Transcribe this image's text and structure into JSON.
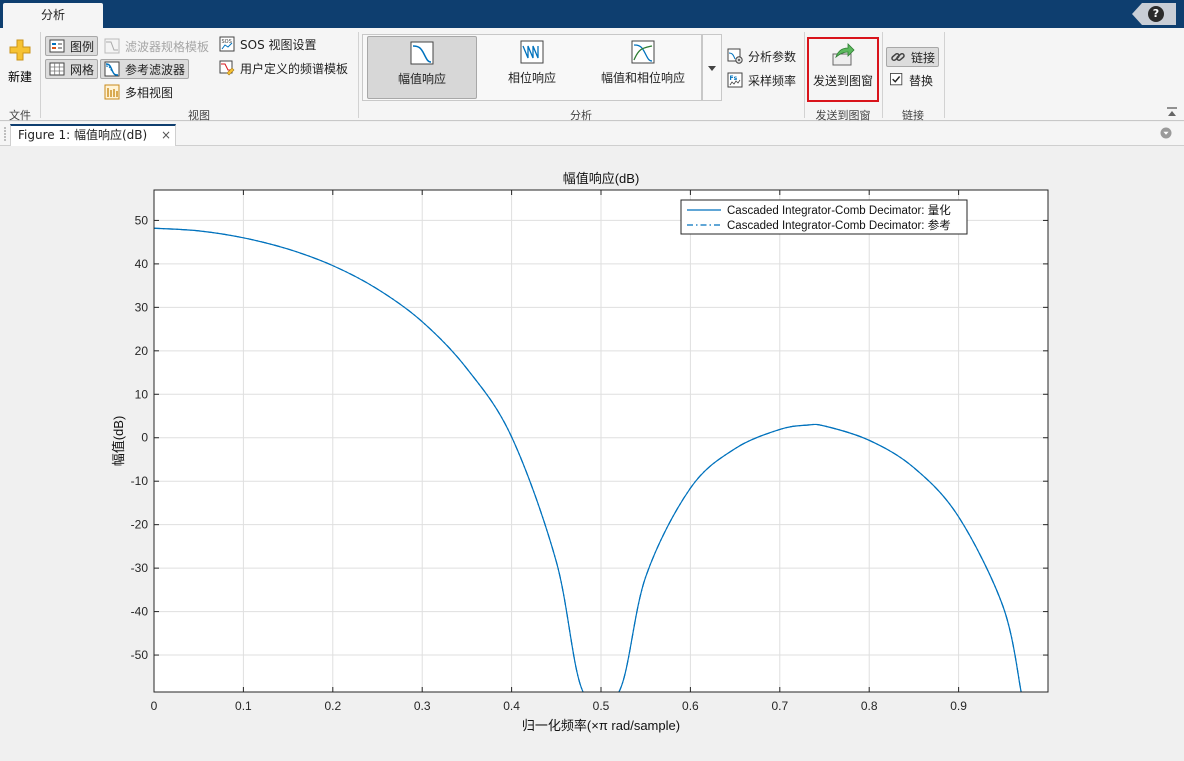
{
  "tabs": {
    "analysis": "分析"
  },
  "help_label": "?",
  "ribbon": {
    "file": {
      "new_label": "新建",
      "section": "文件"
    },
    "view": {
      "section": "视图",
      "legend": "图例",
      "grid": "网格",
      "filter_spec_mask": "滤波器规格模板",
      "reference_filter": "参考滤波器",
      "polyphase_view": "多相视图",
      "sos_view_settings": "SOS 视图设置",
      "user_defined_mask": "用户定义的频谱模板"
    },
    "analysis": {
      "section": "分析",
      "gallery": [
        "幅值响应",
        "相位响应",
        "幅值和相位响应"
      ],
      "analysis_params": "分析参数",
      "sampling_freq": "采样频率"
    },
    "send": {
      "label": "发送到图窗",
      "section": "发送到图窗"
    },
    "link": {
      "label": "链接",
      "replace": "替换",
      "section": "链接"
    }
  },
  "document": {
    "tab_title": "Figure 1: 幅值响应(dB)",
    "close": "×"
  },
  "colors": {
    "accent": "#0e3e6f",
    "series": "#0072bd",
    "highlight": "#d9141b"
  },
  "chart_data": {
    "type": "line",
    "title": "幅值响应(dB)",
    "xlabel": "归一化频率(×π  rad/sample)",
    "ylabel": "幅值(dB)",
    "xlim": [
      0,
      1
    ],
    "ylim": [
      -58.5,
      57
    ],
    "xticks": [
      0,
      0.1,
      0.2,
      0.3,
      0.4,
      0.5,
      0.6,
      0.7,
      0.8,
      0.9
    ],
    "yticks": [
      -50,
      -40,
      -30,
      -20,
      -10,
      0,
      10,
      20,
      30,
      40,
      50
    ],
    "grid": true,
    "legend_position": "top-right",
    "series": [
      {
        "name": "Cascaded Integrator-Comb Decimator: 量化",
        "style": "solid",
        "x": [
          0,
          0.05,
          0.1,
          0.15,
          0.2,
          0.25,
          0.3,
          0.35,
          0.4,
          0.45,
          0.48,
          0.52,
          0.55,
          0.6,
          0.65,
          0.7,
          0.73,
          0.75,
          0.8,
          0.85,
          0.9,
          0.95,
          0.97
        ],
        "y": [
          48.2,
          47.6,
          46.0,
          43.4,
          39.6,
          34.2,
          26.7,
          15.9,
          0.2,
          -28.5,
          -58.5,
          -58.5,
          -32.0,
          -11.6,
          -2.5,
          1.9,
          2.9,
          2.7,
          -0.6,
          -6.9,
          -18.2,
          -39.0,
          -58.5
        ]
      },
      {
        "name": "Cascaded Integrator-Comb Decimator: 参考",
        "style": "dashdot",
        "x": [
          0,
          0.05,
          0.1,
          0.15,
          0.2,
          0.25,
          0.3,
          0.35,
          0.4,
          0.45,
          0.48,
          0.52,
          0.55,
          0.6,
          0.65,
          0.7,
          0.73,
          0.75,
          0.8,
          0.85,
          0.9,
          0.95,
          0.97
        ],
        "y": [
          48.2,
          47.6,
          46.0,
          43.4,
          39.6,
          34.2,
          26.7,
          15.9,
          0.2,
          -28.5,
          -58.5,
          -58.5,
          -32.0,
          -11.6,
          -2.5,
          1.9,
          2.9,
          2.7,
          -0.6,
          -6.9,
          -18.2,
          -39.0,
          -58.5
        ]
      }
    ]
  }
}
